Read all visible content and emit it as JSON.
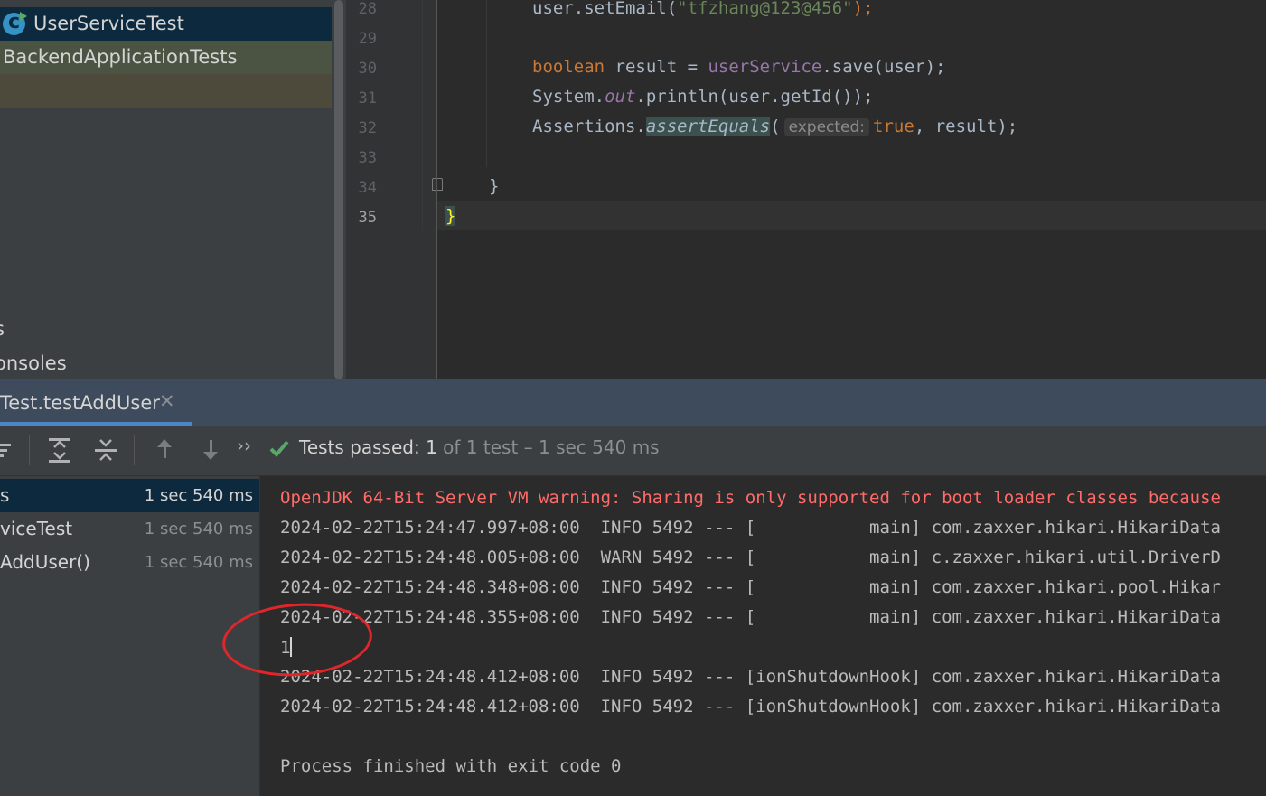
{
  "project_tree": {
    "items": [
      {
        "label": "UserServiceTest",
        "icon": "test-class-icon"
      },
      {
        "label": "BackendApplicationTests"
      },
      {
        "label": ""
      },
      {
        "label": "s"
      },
      {
        "label": "onsoles"
      }
    ]
  },
  "editor": {
    "line_numbers": [
      "28",
      "29",
      "30",
      "31",
      "32",
      "33",
      "34",
      "35"
    ],
    "current_line": "35",
    "code": {
      "l28": {
        "pre": "user.setEmail(",
        "str": "\"tfzhang@123@456\"",
        "post": ");"
      },
      "l30": {
        "kw": "boolean",
        "mid": " result = ",
        "field": "userService",
        "post": ".save(user);"
      },
      "l31": {
        "pre": "System.",
        "static_field": "out",
        "post": ".println(user.getId());"
      },
      "l32": {
        "pre": "Assertions.",
        "static_call": "assertEquals",
        "open": "(",
        "hint": "expected:",
        "kw": "true",
        "post": ", result);"
      },
      "l34": "}",
      "l35": "}"
    }
  },
  "run_window": {
    "tab_label": "Test.testAddUser",
    "toolbar": {
      "more_label": "››",
      "status_prefix": "Tests passed:",
      "status_count": "1",
      "status_suffix": "of 1 test – 1 sec 540 ms"
    },
    "test_tree": [
      {
        "name": "s",
        "time": "1 sec 540 ms"
      },
      {
        "name": "viceTest",
        "time": "1 sec 540 ms"
      },
      {
        "name": "AddUser()",
        "time": "1 sec 540 ms"
      }
    ],
    "console": {
      "warning": "OpenJDK 64-Bit Server VM warning: Sharing is only supported for boot loader classes because",
      "lines": [
        "2024-02-22T15:24:47.997+08:00  INFO 5492 --- [           main] com.zaxxer.hikari.HikariData",
        "2024-02-22T15:24:48.005+08:00  WARN 5492 --- [           main] c.zaxxer.hikari.util.DriverD",
        "2024-02-22T15:24:48.348+08:00  INFO 5492 --- [           main] com.zaxxer.hikari.pool.Hikar",
        "2024-02-22T15:24:48.355+08:00  INFO 5492 --- [           main] com.zaxxer.hikari.HikariData"
      ],
      "output_value": "1",
      "lines_after": [
        "2024-02-22T15:24:48.412+08:00  INFO 5492 --- [ionShutdownHook] com.zaxxer.hikari.HikariData",
        "2024-02-22T15:24:48.412+08:00  INFO 5492 --- [ionShutdownHook] com.zaxxer.hikari.HikariData"
      ],
      "exit_message": "Process finished with exit code 0"
    }
  },
  "colors": {
    "annotation": "#e0262a",
    "success_check": "#59a869",
    "warning_text": "#ff6b68"
  }
}
